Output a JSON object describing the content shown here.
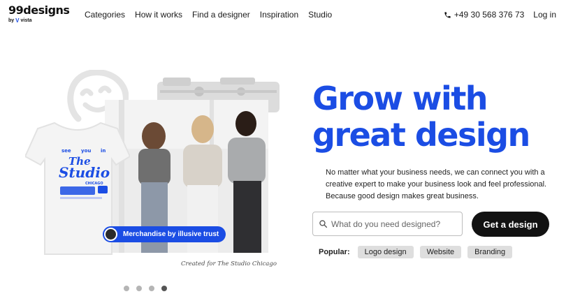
{
  "brand": {
    "name": "99designs",
    "sub_prefix": "by",
    "sub_mark": "V",
    "sub_name": "vista",
    "accent_color": "#1b4de4"
  },
  "nav": {
    "items": [
      {
        "label": "Categories"
      },
      {
        "label": "How it works"
      },
      {
        "label": "Find a designer"
      },
      {
        "label": "Inspiration"
      },
      {
        "label": "Studio"
      }
    ]
  },
  "header_right": {
    "phone_icon": "phone-icon",
    "phone": "+49 30 568 376 73",
    "login": "Log in"
  },
  "hero": {
    "headline_line1": "Grow with",
    "headline_line2": "great design",
    "subtext": "No matter what your business needs, we can connect you with a creative expert to make your business look and feel professional. Because good design makes great business.",
    "search_placeholder": "What do you need designed?",
    "search_icon": "search-icon",
    "cta": "Get a design",
    "popular_label": "Popular:",
    "popular_chips": [
      {
        "label": "Logo design"
      },
      {
        "label": "Website"
      },
      {
        "label": "Branding"
      }
    ]
  },
  "showcase": {
    "merch_pill": "Merchandise by illusive trust",
    "caption": "Created for The Studio Chicago",
    "shirt_text": {
      "top_words": [
        "see",
        "you",
        "in"
      ],
      "the": "The",
      "studio": "Studio",
      "city": "CHICAGO"
    },
    "carousel": {
      "count": 4,
      "active_index": 3
    }
  }
}
